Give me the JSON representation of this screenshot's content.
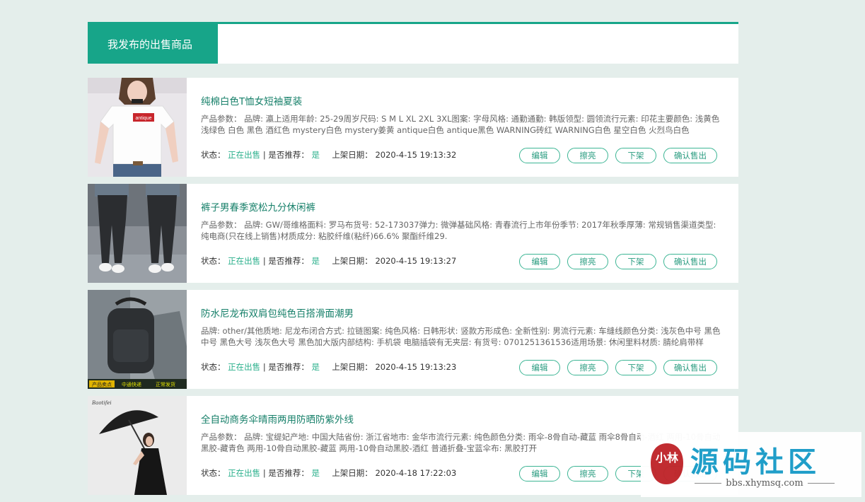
{
  "header": {
    "title": "我发布的出售商品"
  },
  "labels": {
    "status": "状态：",
    "recommend": "| 是否推荐：",
    "date": "上架日期："
  },
  "buttons": {
    "edit": "编辑",
    "polish": "擦亮",
    "offshelf": "下架",
    "confirm_sold": "确认售出"
  },
  "items": [
    {
      "title": "纯棉白色T恤女短袖夏装",
      "params": "产品参数：  品牌: 瀛上适用年龄: 25-29周岁尺码: S M L XL 2XL 3XL图案: 字母风格: 通勤通勤: 韩版领型: 圆领流行元素: 印花主要颜色: 浅黄色 浅绿色 白色 黑色 酒红色 mystery白色 mystery姜黄 antique白色 antique黑色 WARNING砖红 WARNING白色 星空白色 火烈鸟白色",
      "status": "正在出售",
      "recommended": "是",
      "date": "2020-4-15 19:13:32"
    },
    {
      "title": "裤子男春季宽松九分休闲裤",
      "params": "产品参数：  品牌: GW/哥维格面料: 罗马布货号: 52-173037弹力: 微弹基础风格: 青春流行上市年份季节: 2017年秋季厚薄: 常规销售渠道类型: 纯电商(只在线上销售)材质成分: 粘胶纤维(粘纤)66.6% 聚酯纤维29.",
      "status": "正在出售",
      "recommended": "是",
      "date": "2020-4-15 19:13:27"
    },
    {
      "title": "防水尼龙布双肩包纯色百搭滑面潮男",
      "params": "品牌: other/其他质地: 尼龙布闭合方式: 拉链图案: 纯色风格: 日韩形状: 竖款方形成色: 全新性别: 男流行元素: 车缝线颜色分类: 浅灰色中号 黑色中号 黑色大号 浅灰色大号 黑色加大版内部结构: 手机袋 电脑插袋有无夹层: 有货号: 0701251361536适用场景: 休闲里料材质: 腈纶肩带样",
      "status": "正在出售",
      "recommended": "是",
      "date": "2020-4-15 19:13:23",
      "thumb_tags": [
        "产品卖点",
        "中通快递",
        "正常发货"
      ]
    },
    {
      "title": "全自动商务伞晴雨两用防晒防紫外线",
      "params": "产品参数：  品牌: 宝缇妃产地: 中国大陆省份: 浙江省地市: 金华市流行元素: 纯色颜色分类: 雨伞-8骨自动-藏蓝 雨伞8骨自动-酒红 两用-10骨自动黑胶-藏青色 两用-10骨自动黑胶-藏蓝 两用-10骨自动黑胶-酒红 普通折叠-宝蓝伞布: 黑胶打开",
      "status": "正在出售",
      "recommended": "是",
      "date": "2020-4-18 17:22:03",
      "thumb_brand": "Baotifei"
    }
  ],
  "thumb_1_print": "antique",
  "watermark": {
    "title": "源码社区",
    "seal": "小林",
    "url": "bbs.xhymsq.com"
  },
  "colors": {
    "accent": "#17a589",
    "page_bg": "#e4eeeb",
    "link_green": "#2bb08c"
  }
}
